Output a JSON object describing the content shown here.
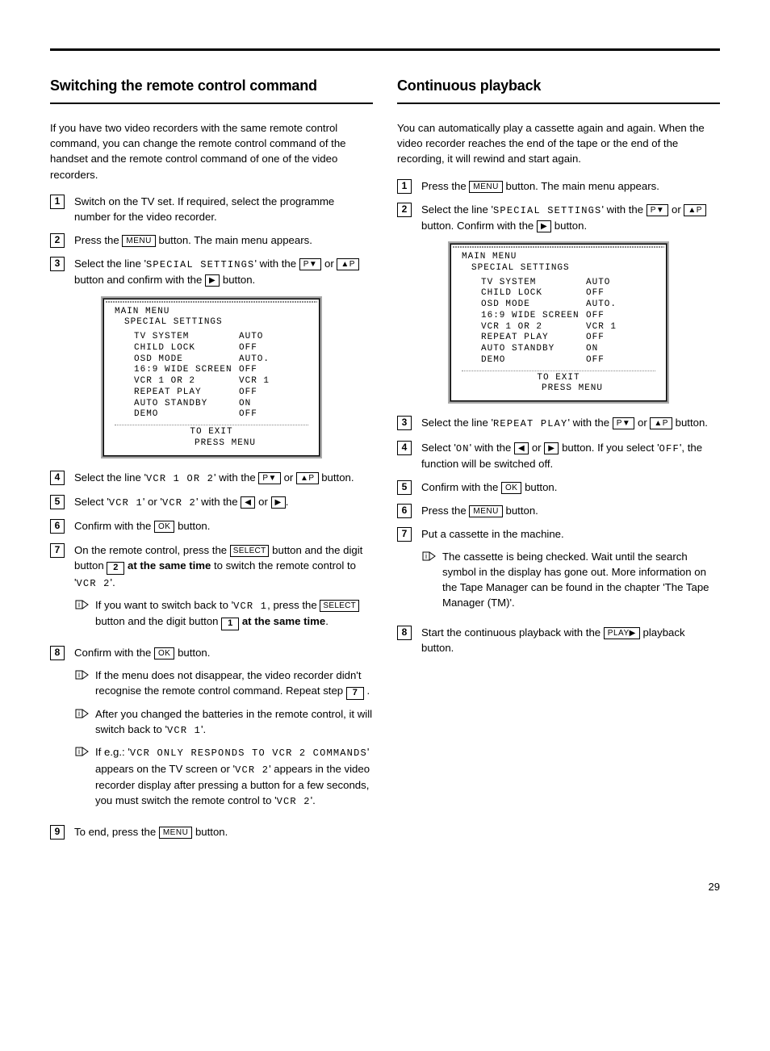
{
  "page_number": "29",
  "left": {
    "title": "Switching the remote control command",
    "intro": "If you have two video recorders with the same remote control command, you can change the remote control command of the handset and the remote control command of one of the video recorders.",
    "steps": {
      "s1": "Switch on the TV set. If required, select the programme number for the video recorder.",
      "s2a": "Press the ",
      "s2b": " button. The main menu appears.",
      "s3a": "Select the line '",
      "s3txt": "SPECIAL SETTINGS",
      "s3b": "' with the ",
      "s3c": " or ",
      "s3d": " button and confirm with the ",
      "s3e": " button.",
      "s4a": "Select the line '",
      "s4txt": "VCR 1 OR 2",
      "s4b": "' with the ",
      "s4c": " or ",
      "s4d": " button.",
      "s5a": "Select '",
      "s5txt1": "VCR 1",
      "s5b": "' or '",
      "s5txt2": "VCR 2",
      "s5c": "' with the ",
      "s5d": " or ",
      "s5e": ".",
      "s6a": "Confirm with the ",
      "s6b": " button.",
      "s7a": "On the remote control, press the ",
      "s7b": " button and the digit button ",
      "s7c": " at the same time",
      "s7d": " to switch the remote control to '",
      "s7txt": "VCR 2",
      "s7e": "'.",
      "n7a": "If you want to switch back to '",
      "n7txt": "VCR 1",
      "n7b": ", press the ",
      "n7c": " button and the digit button ",
      "n7d": " at the same time",
      "n7e": ".",
      "s8a": "Confirm with the ",
      "s8b": " button.",
      "n8a": "If the menu does not disappear, the video recorder didn't recognise the remote control command. Repeat step ",
      "n8b": " .",
      "n8c_a": "After you changed the batteries in the remote control, it will switch back to '",
      "n8c_txt": "VCR 1",
      "n8c_b": "'.",
      "n8d_a": "If e.g.: '",
      "n8d_txt1": "VCR ONLY RESPONDS TO VCR 2 COMMANDS",
      "n8d_b": "' appears on the TV screen or '",
      "n8d_txt2": "VCR 2",
      "n8d_c": "' appears in the video recorder display after pressing a button for a few seconds, you must switch the remote control to '",
      "n8d_txt3": "VCR 2",
      "n8d_d": "'.",
      "s9a": "To end, press the ",
      "s9b": " button."
    },
    "buttons": {
      "menu": "MENU",
      "pdown": "P",
      "pup": "P",
      "right": "",
      "left": "",
      "ok": "OK",
      "select": "SELECT",
      "digit2": "2",
      "digit1": "1",
      "step7": "7"
    }
  },
  "right": {
    "title": "Continuous playback",
    "intro": "You can automatically play a cassette again and again. When the video recorder reaches the end of the tape or the end of the recording, it will rewind and start again.",
    "steps": {
      "s1a": "Press the ",
      "s1b": " button. The main menu appears.",
      "s2a": "Select the line '",
      "s2txt": "SPECIAL SETTINGS",
      "s2b": "' with the ",
      "s2c": " or ",
      "s2d": " button. Confirm with the ",
      "s2e": " button.",
      "s3a": "Select the line '",
      "s3txt": "REPEAT PLAY",
      "s3b": "' with the ",
      "s3c": " or ",
      "s3d": " button.",
      "s4a": "Select '",
      "s4txt1": "ON",
      "s4b": "' with the ",
      "s4c": " or ",
      "s4d": " button. If you select '",
      "s4txt2": "OFF",
      "s4e": "', the function will be switched off.",
      "s5a": "Confirm with the ",
      "s5b": " button.",
      "s6a": "Press the ",
      "s6b": " button.",
      "s7": "Put a cassette in the machine.",
      "n7": "The cassette is being checked. Wait until the search symbol in the display has gone out. More information on the Tape Manager can be found in the chapter 'The Tape Manager (TM)'.",
      "s8a": "Start the continuous playback with the ",
      "s8b": " playback button."
    },
    "buttons": {
      "menu": "MENU",
      "ok": "OK",
      "play": "PLAY"
    }
  },
  "screen": {
    "title": "MAIN MENU",
    "subtitle": "SPECIAL SETTINGS",
    "rows": [
      {
        "k": "TV SYSTEM",
        "v": "AUTO"
      },
      {
        "k": "CHILD LOCK",
        "v": "OFF"
      },
      {
        "k": "OSD MODE",
        "v": "AUTO."
      },
      {
        "k": "16:9 WIDE SCREEN",
        "v": "OFF"
      },
      {
        "k": "VCR 1 OR 2",
        "v": "VCR 1"
      },
      {
        "k": "REPEAT PLAY",
        "v": "OFF"
      },
      {
        "k": "AUTO STANDBY",
        "v": "ON"
      },
      {
        "k": "DEMO",
        "v": "OFF"
      }
    ],
    "exit1": "TO EXIT",
    "exit2": "PRESS  MENU"
  }
}
